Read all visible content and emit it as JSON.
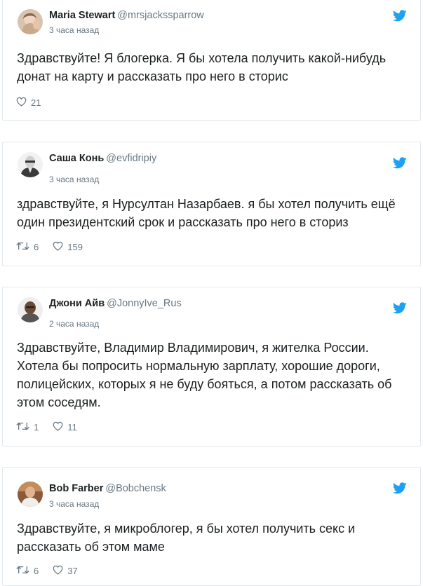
{
  "tweets": [
    {
      "name": "Maria Stewart",
      "handle": "@mrsjackssparrow",
      "time": "3 часа назад",
      "text": "Здравствуйте! Я блогерка. Я бы хотела получить какой-нибудь донат на карту и рассказать про него в сторис",
      "retweets": null,
      "likes": "21"
    },
    {
      "name": "Саша Конь",
      "handle": "@evfidripiy",
      "time": "3 часа назад",
      "text": "здравствуйте, я Нурсултан Назарбаев. я бы хотел получить ещё один президентский срок и рассказать про него в сториз",
      "retweets": "6",
      "likes": "159"
    },
    {
      "name": "Джони Айв",
      "handle": "@JonnyIve_Rus",
      "time": "2 часа назад",
      "text": "Здравствуйте, Владимир Владимирович, я жителка России. Хотела бы попросить нормальную зарплату, хорошие дороги, полицейских, которых я не буду бояться, а потом рассказать об этом соседям.",
      "retweets": "1",
      "likes": "11"
    },
    {
      "name": "Bob Farber",
      "handle": "@Bobchensk",
      "time": "3 часа назад",
      "text": "Здравствуйте, я микроблогер, я бы хотел получить секс и рассказать об этом маме",
      "retweets": "6",
      "likes": "37"
    }
  ],
  "colors": {
    "twitter_blue": "#1da1f2",
    "meta_gray": "#697882",
    "border": "#e1e8ed"
  },
  "icons": {
    "brand": "twitter-bird-icon",
    "retweet": "retweet-icon",
    "like": "heart-icon"
  }
}
